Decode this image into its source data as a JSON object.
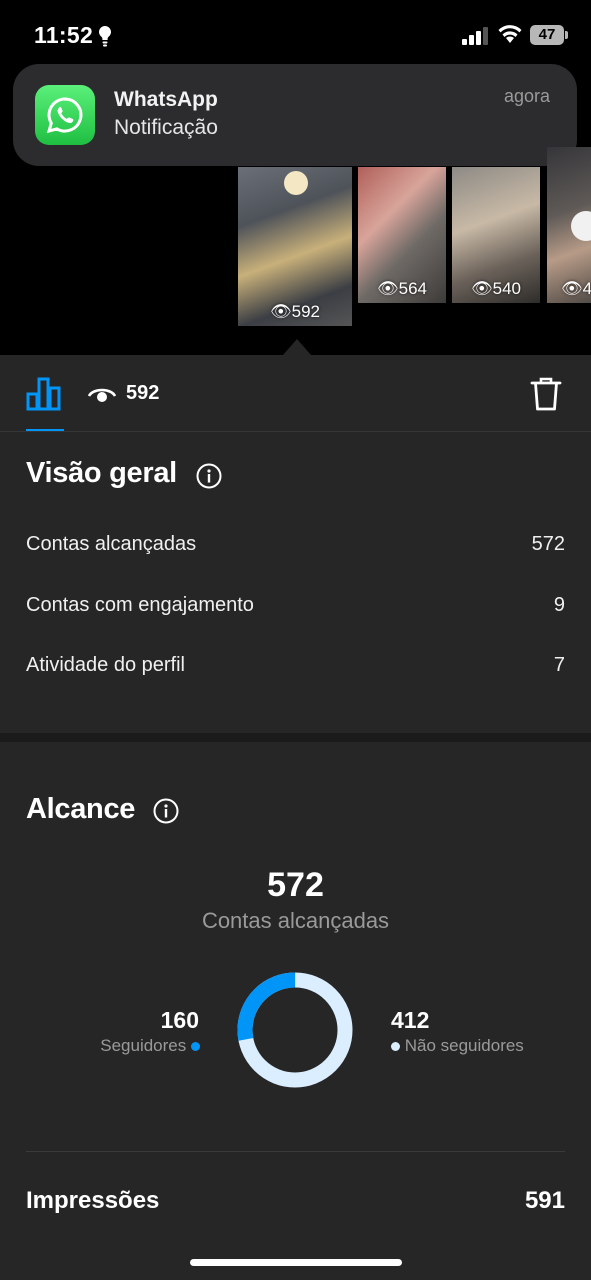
{
  "status_bar": {
    "time": "11:52",
    "battery": "47"
  },
  "notification": {
    "app": "WhatsApp",
    "message": "Notificação",
    "time": "agora"
  },
  "stories": [
    {
      "views": "592"
    },
    {
      "views": "564"
    },
    {
      "views": "540"
    },
    {
      "views": "4"
    }
  ],
  "tabbar": {
    "views": "592"
  },
  "overview": {
    "title": "Visão geral",
    "rows": [
      {
        "label": "Contas alcançadas",
        "value": "572"
      },
      {
        "label": "Contas com engajamento",
        "value": "9"
      },
      {
        "label": "Atividade do perfil",
        "value": "7"
      }
    ]
  },
  "reach": {
    "title": "Alcance",
    "total": "572",
    "total_label": "Contas alcançadas",
    "followers": {
      "value": "160",
      "label": "Seguidores",
      "color": "#0095f6"
    },
    "non_followers": {
      "value": "412",
      "label": "Não seguidores",
      "color": "#dbeeff"
    },
    "follower_fraction": 0.28
  },
  "impressions": {
    "label": "Impressões",
    "value": "591"
  },
  "colors": {
    "accent": "#0095f6",
    "panel": "#262626"
  }
}
